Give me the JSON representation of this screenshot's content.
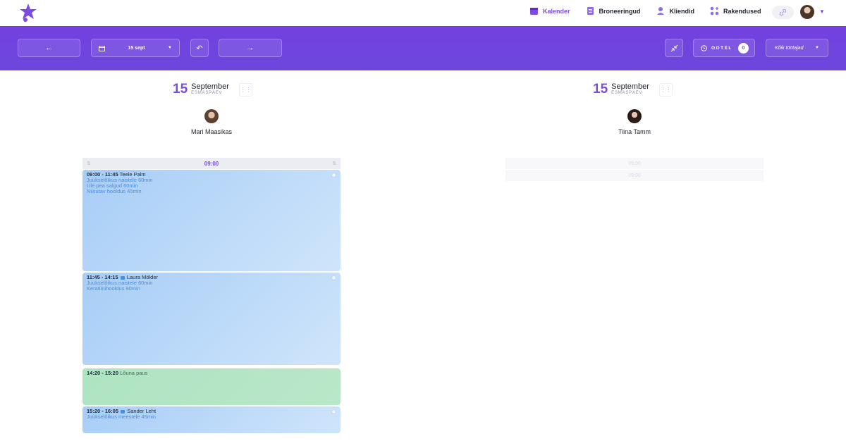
{
  "nav": {
    "links": [
      {
        "label": "Kalender",
        "icon": "calendar-icon",
        "active": true
      },
      {
        "label": "Broneeringud",
        "icon": "document-icon",
        "active": false
      },
      {
        "label": "Kliendid",
        "icon": "user-icon",
        "active": false
      },
      {
        "label": "Rakendused",
        "icon": "apps-icon",
        "active": false
      }
    ]
  },
  "toolbar": {
    "prev_icon": "←",
    "date_label": "15 sept",
    "undo_icon": "↶",
    "next_icon": "→",
    "waiting_label": "OOTEL",
    "waiting_count": "0",
    "staff_select": "Kõik töötajad"
  },
  "columns": [
    {
      "day": "15",
      "month": "September",
      "weekday": "ESMASPÄEV",
      "staff_name": "Mari Maasikas",
      "first_time": "09:00",
      "appointments": [
        {
          "time": "09:00 - 11:45",
          "customer": "Teele Palm",
          "chat": false,
          "services": [
            "Juukselõikus naistele 60min",
            "Üle pea salgud 60min",
            "Niisutav hooldus 45min"
          ]
        },
        {
          "time": "11:45 - 14:15",
          "customer": "Laura Mölder",
          "chat": true,
          "services": [
            "Juukselõikus naistele 60min",
            "Keratiinihooldus 90min"
          ]
        },
        {
          "time": "14:20 - 15:20",
          "customer": "Lõuna paus",
          "chat": false,
          "services": []
        },
        {
          "time": "15:20 - 16:05",
          "customer": "Sander Leht",
          "chat": true,
          "services": [
            "Juukselõikus meestele 45min"
          ]
        }
      ]
    },
    {
      "day": "15",
      "month": "September",
      "weekday": "ESMASPÄEV",
      "staff_name": "Tiina Tamm",
      "ghost_times": [
        "09:00",
        "09:00"
      ]
    }
  ],
  "colors": {
    "accent": "#7b4ce0",
    "toolbar": "#7440e0",
    "appointment": "#a7cdf6",
    "break": "#aee4c2"
  }
}
